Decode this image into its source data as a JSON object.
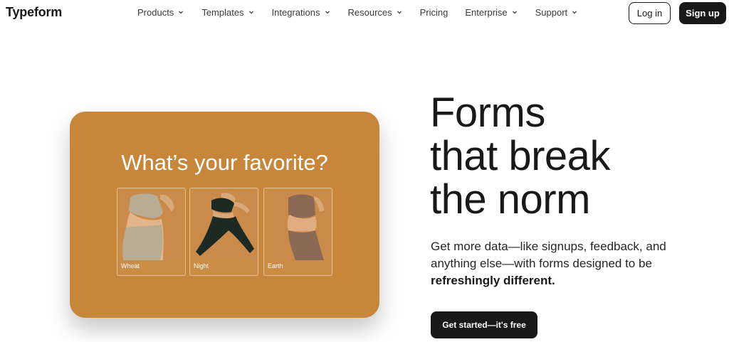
{
  "brand": {
    "logo_text": "Typeform"
  },
  "nav": {
    "items": [
      {
        "label": "Products",
        "has_dropdown": true
      },
      {
        "label": "Templates",
        "has_dropdown": true
      },
      {
        "label": "Integrations",
        "has_dropdown": true
      },
      {
        "label": "Resources",
        "has_dropdown": true
      },
      {
        "label": "Pricing",
        "has_dropdown": false
      },
      {
        "label": "Enterprise",
        "has_dropdown": true
      },
      {
        "label": "Support",
        "has_dropdown": true
      }
    ],
    "login_label": "Log in",
    "signup_label": "Sign up"
  },
  "card": {
    "question": "What’s your favorite?",
    "background_color": "#c8863a",
    "options": [
      {
        "label": "Wheat",
        "color": "#b8ad94"
      },
      {
        "label": "Night",
        "color": "#1d2a24"
      },
      {
        "label": "Earth",
        "color": "#8b6a55"
      }
    ]
  },
  "hero": {
    "title_lines": [
      "Forms",
      "that break",
      "the norm"
    ],
    "subtitle_prefix": "Get more data—like signups, feedback, and anything else—with forms designed to be ",
    "subtitle_bold": "refreshingly different.",
    "cta_label": "Get started—it's free"
  }
}
